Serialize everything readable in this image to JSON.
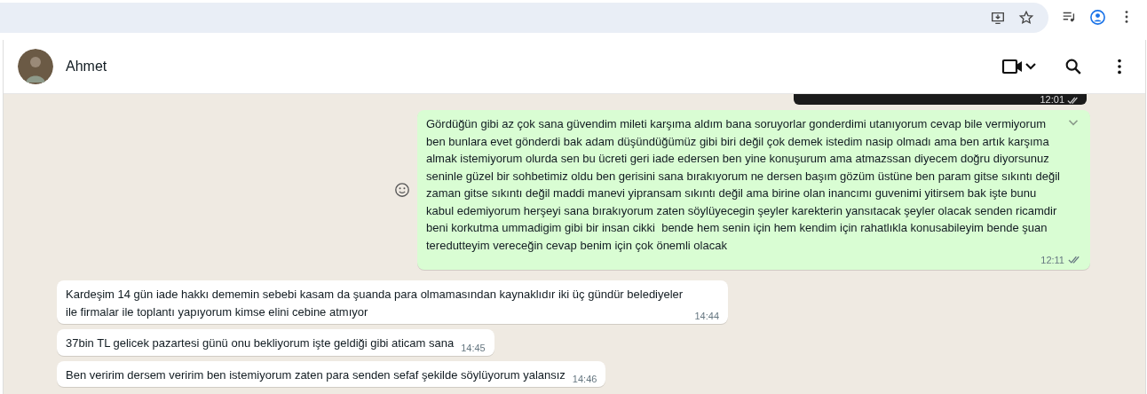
{
  "chat_header": {
    "contact_name": "Ahmet"
  },
  "messages": [
    {
      "kind": "media",
      "time": "12:01",
      "read": true
    },
    {
      "kind": "outgoing",
      "text": "Gördüğün gibi az çok sana güvendim mileti karşıma aldım bana soruyorlar gonderdimi utanıyorum cevap bile vermiyorum ben bunlara evet gönderdi bak adam düşündüğümüz gibi biri değil çok demek istedim nasip olmadı ama ben artık karşıma almak istemiyorum olurda sen bu ücreti geri iade edersen ben yine konuşurum ama atmazssan diyecem doğru diyorsunuz seninle güzel bir sohbetimiz oldu ben gerisini sana bırakıyorum ne dersen başım gözüm üstüne ben param gitse sıkıntı değil zaman gitse sıkıntı değil maddi manevi yipransam sıkıntı değil ama birine olan inancımı guvenimi yitirsem bak işte bunu kabul edemiyorum herşeyi sana bırakıyorum zaten söylüyecegin şeyler karekterin yansıtacak şeyler olacak senden ricamdir beni korkutma ummadigim gibi bir insan cikki  bende hem senin için hem kendim için rahatlıkla konusabileyim bende şuan teredutteyim vereceğin cevap benim için çok önemli olacak",
      "time": "12:11",
      "read": true
    },
    {
      "kind": "incoming",
      "text": "Kardeşim 14 gün iade hakkı dememin sebebi kasam da şuanda para olmamasından kaynaklıdır iki üç gündür belediyeler ile firmalar ile toplantı yapıyorum kimse elini cebine atmıyor",
      "time": "14:44"
    },
    {
      "kind": "incoming",
      "text": "37bin TL gelicek pazartesi günü onu bekliyorum işte geldiği gibi aticam sana",
      "time": "14:45"
    },
    {
      "kind": "incoming",
      "text": "Ben veririm dersem veririm ben istemiyorum zaten para senden sefaf şekilde söylüyorum yalansız",
      "time": "14:46"
    }
  ]
}
